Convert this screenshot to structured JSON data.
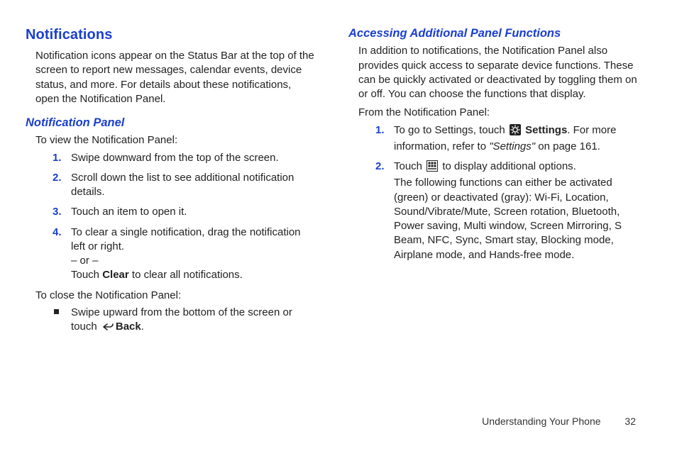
{
  "left": {
    "h1": "Notifications",
    "intro": "Notification icons appear on the Status Bar at the top of the screen to report new messages, calendar events, device status, and more. For details about these notifications, open the Notification Panel.",
    "h2": "Notification Panel",
    "view_intro": "To view the Notification Panel:",
    "steps": [
      "Swipe downward from the top of the screen.",
      "Scroll down the list to see additional notification details.",
      "Touch an item to open it."
    ],
    "step4_a": "To clear a single notification, drag the notification left or right.",
    "step4_or": "– or –",
    "step4_b_pre": "Touch ",
    "step4_b_bold": "Clear",
    "step4_b_post": " to clear all notifications.",
    "close_intro": "To close the Notification Panel:",
    "close_pre": "Swipe upward from the bottom of the screen or touch ",
    "close_bold": "Back",
    "close_post": "."
  },
  "right": {
    "h2": "Accessing Additional Panel Functions",
    "intro": "In addition to notifications, the Notification Panel also provides quick access to separate device functions. These can be quickly activated or deactivated by toggling them on or off. You can choose the functions that display.",
    "from": "From the Notification Panel:",
    "s1_a": "To go to Settings, touch ",
    "s1_bold": "Settings",
    "s1_b": ". For more information, refer to ",
    "s1_ital": "\"Settings\"",
    "s1_c": "  on page 161.",
    "s2_a": "Touch ",
    "s2_b": " to display additional options.",
    "s2_body": "The following functions can either be activated (green) or deactivated (gray): Wi-Fi, Location, Sound/Vibrate/Mute, Screen rotation, Bluetooth, Power saving, Multi window, Screen Mirroring, S Beam, NFC, Sync, Smart stay, Blocking mode, Airplane mode, and Hands-free mode."
  },
  "footer": {
    "chapter": "Understanding Your Phone",
    "page": "32"
  }
}
